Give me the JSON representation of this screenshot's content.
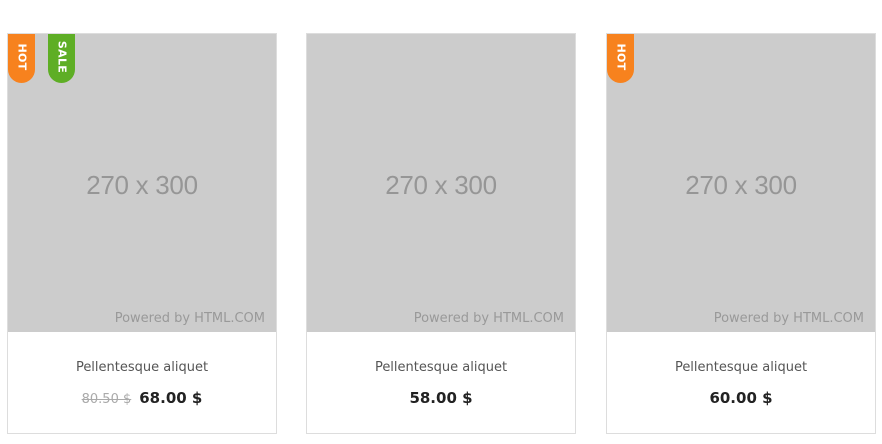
{
  "products": [
    {
      "title": "Pellentesque aliquet",
      "old_price": "80.50 $",
      "price": "68.00 $",
      "placeholder_size": "270 x 300",
      "placeholder_credit": "Powered by HTML.COM",
      "badges": [
        "HOT",
        "SALE"
      ]
    },
    {
      "title": "Pellentesque aliquet",
      "price": "58.00 $",
      "placeholder_size": "270 x 300",
      "placeholder_credit": "Powered by HTML.COM"
    },
    {
      "title": "Pellentesque aliquet",
      "price": "60.00 $",
      "placeholder_size": "270 x 300",
      "placeholder_credit": "Powered by HTML.COM",
      "badges": [
        "HOT"
      ]
    }
  ],
  "colors": {
    "hot_badge": "#f7821e",
    "sale_badge": "#5eae25",
    "placeholder_bg": "#cccccc"
  }
}
